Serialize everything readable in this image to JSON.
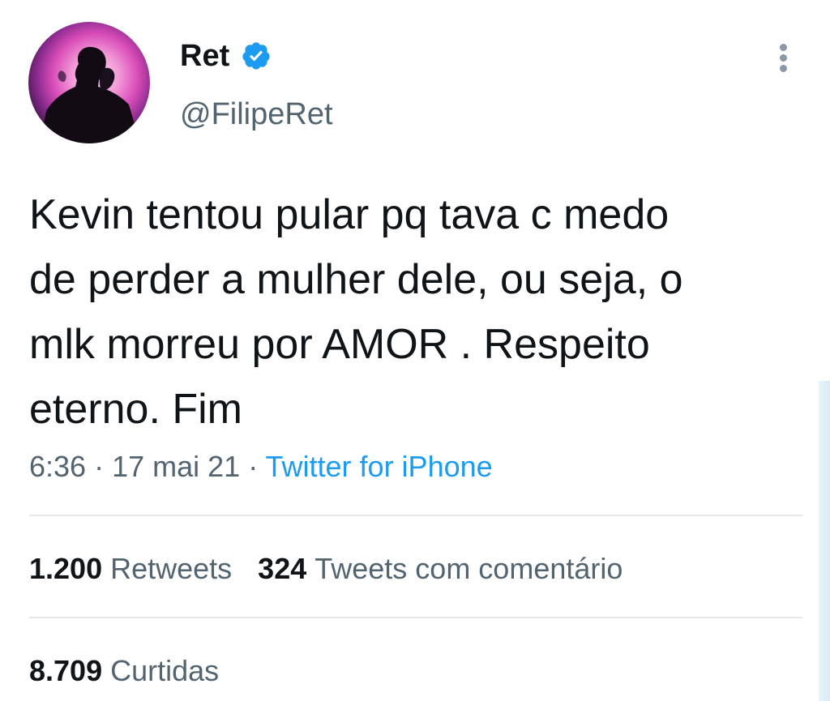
{
  "author": {
    "display_name": "Ret",
    "handle": "@FilipeRet",
    "verified": true,
    "avatar": "profile-photo"
  },
  "tweet": {
    "text": "Kevin tentou pular pq tava c medo\nde perder a mulher dele, ou seja, o\nmlk morreu por AMOR . Respeito\neterno. Fim",
    "time": "6:36",
    "separator_1": " · ",
    "date": "17 mai 21",
    "separator_2": " · ",
    "source": "Twitter for iPhone"
  },
  "stats": {
    "retweets_count": "1.200",
    "retweets_label": "Retweets",
    "quotes_count": "324",
    "quotes_label": "Tweets com comentário",
    "likes_count": "8.709",
    "likes_label": "Curtidas"
  },
  "icons": {
    "verified": "verified-badge-icon",
    "more": "more-vertical-icon"
  },
  "colors": {
    "text": "#0f1419",
    "secondary": "#536471",
    "link": "#1d9bf0",
    "verified": "#1d9bf0",
    "divider": "#e6e9ec"
  }
}
